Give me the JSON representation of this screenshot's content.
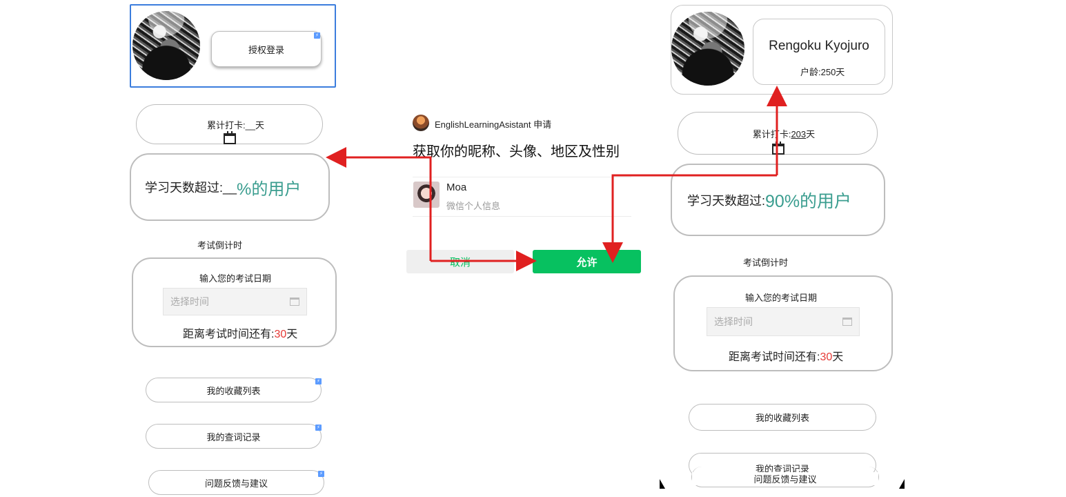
{
  "left_panel": {
    "auth_button": "授权登录",
    "checkin_label": "累计打卡:__天",
    "study_prefix": "学习天数超过:__",
    "study_suffix": "%的用户",
    "countdown_title": "考试倒计时",
    "exam_date_label": "输入您的考试日期",
    "date_placeholder": "选择时间",
    "remain_prefix": "距离考试时间还有:",
    "remain_days": "30",
    "remain_suffix": "天",
    "menu": [
      "我的收藏列表",
      "我的查词记录",
      "问题反馈与建议"
    ]
  },
  "dialog": {
    "app_name": "EnglishLearningAsistant 申请",
    "title": "获取你的昵称、头像、地区及性别",
    "user_name": "Moa",
    "user_sub": "微信个人信息",
    "cancel": "取消",
    "allow": "允许"
  },
  "right_panel": {
    "user_name": "Rengoku Kyojuro",
    "user_age": "户龄:250天",
    "checkin_prefix": "累计打卡:",
    "checkin_days": "203",
    "checkin_suffix": "天",
    "study_prefix": "学习天数超过:",
    "study_suffix": "90%的用户",
    "countdown_title": "考试倒计时",
    "exam_date_label": "输入您的考试日期",
    "date_placeholder": "选择时间",
    "remain_prefix": "距离考试时间还有:",
    "remain_days": "30",
    "remain_suffix": "天",
    "menu": [
      "我的收藏列表",
      "我的查词记录",
      "问题反馈与建议"
    ]
  },
  "colors": {
    "accent_green": "#3a9d8f",
    "wechat_green": "#07c160",
    "arrow_red": "#e02020"
  }
}
